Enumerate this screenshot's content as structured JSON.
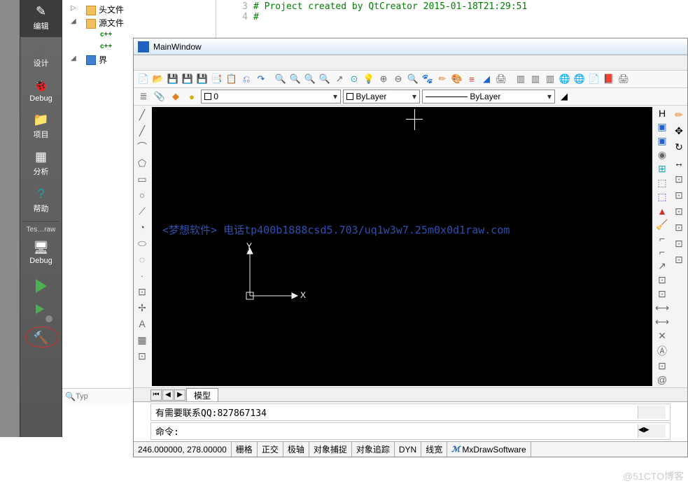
{
  "qt_sidebar": {
    "items": [
      {
        "icon": "✎",
        "label": "编辑"
      },
      {
        "icon": "✕",
        "label": "设计"
      },
      {
        "icon": "🐞",
        "label": "Debug"
      },
      {
        "icon": "📁",
        "label": "项目"
      },
      {
        "icon": "▦",
        "label": "分析"
      },
      {
        "icon": "?",
        "label": "帮助"
      }
    ],
    "project_label": "Tes…raw",
    "config_label": "Debug"
  },
  "project_tree": {
    "items": [
      {
        "indent": 1,
        "exp": "▷",
        "icon": "folder",
        "label": "头文件"
      },
      {
        "indent": 1,
        "exp": "◢",
        "icon": "folder",
        "label": "源文件"
      },
      {
        "indent": 2,
        "exp": "",
        "icon": "cpp",
        "label": ""
      },
      {
        "indent": 2,
        "exp": "",
        "icon": "cpp",
        "label": ""
      },
      {
        "indent": 1,
        "exp": "◢",
        "icon": "blue",
        "label": "界"
      }
    ]
  },
  "code": {
    "lines": [
      {
        "num": "3",
        "text": "# Project created by QtCreator 2015-01-18T21:29:51"
      },
      {
        "num": "4",
        "text": "#"
      }
    ]
  },
  "cad": {
    "title": "MainWindow",
    "toolbar1": [
      "📄",
      "📂",
      "💾",
      "💾",
      "💾",
      "📑",
      "📋",
      "⎌",
      "↷",
      "",
      "🔍",
      "🔍",
      "🔍",
      "🔍",
      "↗",
      "⊙",
      "💡",
      "⊕",
      "⊖",
      "🔍",
      "🐾",
      "✏",
      "🎨",
      "≡",
      "◢",
      "🖨",
      "",
      "▥",
      "▥",
      "▥",
      "🌐",
      "🌐",
      "📄",
      "📕",
      "🖨"
    ],
    "toolbar1_colors": [
      "c-blue",
      "c-orange",
      "c-blue",
      "c-blue",
      "c-purple",
      "c-gray",
      "c-gray",
      "c-blue",
      "c-blue",
      "",
      "c-cyan",
      "c-cyan",
      "c-cyan",
      "c-cyan",
      "c-gray",
      "c-cyan",
      "c-yellow",
      "c-gray",
      "c-gray",
      "c-green",
      "c-orange",
      "c-orange",
      "c-gray",
      "c-red",
      "c-blue",
      "c-gray",
      "",
      "c-gray",
      "c-gray",
      "c-gray",
      "c-green",
      "c-green",
      "c-orange",
      "c-red",
      "c-gray"
    ],
    "layer_icons": [
      "≣",
      "📎",
      "◆",
      "●"
    ],
    "layer_dropdown": "0",
    "bylayer1": "ByLayer",
    "bylayer2": "ByLayer",
    "left_tools": [
      "╱",
      "╱",
      "⌒",
      "⬠",
      "▭",
      "○",
      "⟋",
      "◔",
      "⬭",
      "◌",
      "·",
      "⊡",
      "✢",
      "A",
      "▦",
      "⊡"
    ],
    "right_tools_a": [
      "H",
      "▣",
      "▣",
      "◉",
      "⊞",
      "⬚",
      "⬚",
      "▲",
      "🧹",
      "⌐",
      "⌐",
      "↗",
      "⊡",
      "⊡",
      "⟷",
      "⟷",
      "✕",
      "Ⓐ",
      "⊡",
      "@"
    ],
    "right_tools_a_colors": [
      "c-black",
      "c-blue",
      "c-blue",
      "c-gray",
      "c-cyan",
      "c-gray",
      "c-purple",
      "c-red",
      "c-orange",
      "c-gray",
      "c-gray",
      "c-gray",
      "c-gray",
      "c-gray",
      "c-gray",
      "c-gray",
      "c-gray",
      "c-gray",
      "c-gray",
      "c-gray"
    ],
    "right_tools_b": [
      "✏",
      "✥",
      "↻",
      "↔",
      "⊡",
      "⊡",
      "⊡",
      "⊡",
      "⊡",
      "⊡"
    ],
    "right_tools_b_colors": [
      "c-orange",
      "c-black",
      "c-black",
      "c-black",
      "c-gray",
      "c-gray",
      "c-gray",
      "c-gray",
      "c-gray",
      "c-gray"
    ],
    "watermark": "<梦想软件>  电话tp400b1888csd5.703/uq1w3w7.25m0x0d1raw.com",
    "ucs": {
      "x": "X",
      "y": "Y"
    },
    "tab_label": "模型",
    "cmd_history": "有需要联系QQ:827867134",
    "cmd_prompt": "命令:",
    "status": {
      "coords": "246.000000, 278.00000",
      "items": [
        "栅格",
        "正交",
        "极轴",
        "对象捕捉",
        "对象追踪",
        "DYN",
        "线宽"
      ],
      "brand": "MxDrawSoftware"
    }
  },
  "search_placeholder": "Typ",
  "corner_wm": "@51CTO博客"
}
